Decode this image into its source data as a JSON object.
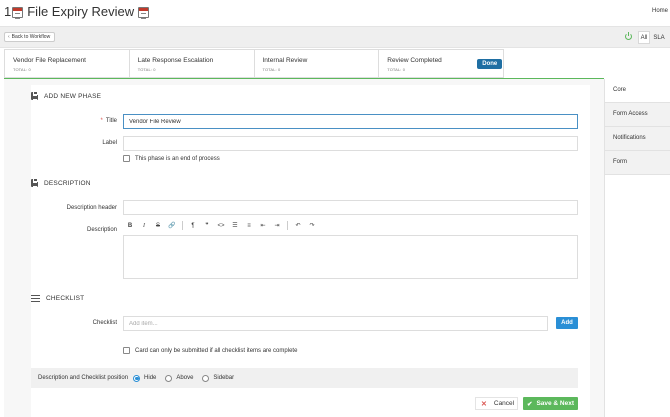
{
  "header": {
    "title_prefix": "1",
    "title": "File Expiry Review",
    "home_link": "Home"
  },
  "actionbar": {
    "back_label": "Back to Workflow",
    "filter_all": "All",
    "filter_sla": "SLA"
  },
  "stages": [
    {
      "name": "Vendor File Replacement",
      "total": "TOTAL: 0"
    },
    {
      "name": "Late Response Escalation",
      "total": "TOTAL: 0"
    },
    {
      "name": "Internal Review",
      "total": "TOTAL: 0"
    },
    {
      "name": "Review Completed",
      "total": "TOTAL: 0",
      "badge": "Done"
    }
  ],
  "add_phase": {
    "heading": "ADD NEW PHASE",
    "title_label": "Title",
    "title_value": "Vendor File Review",
    "label_label": "Label",
    "label_value": "",
    "end_process_label": "This phase is an end of process"
  },
  "description": {
    "heading": "DESCRIPTION",
    "header_label": "Description header",
    "header_value": "",
    "body_label": "Description",
    "toolbar": [
      "B",
      "I",
      "S",
      "link",
      "¶",
      "❞",
      "<>",
      "ul",
      "ol",
      "outdent",
      "indent",
      "undo",
      "redo"
    ]
  },
  "checklist": {
    "heading": "CHECKLIST",
    "label": "Checklist",
    "placeholder": "Add item...",
    "add_label": "Add",
    "require_label": "Card can only be submitted if all checklist items are complete"
  },
  "position": {
    "label": "Description and Checklist position",
    "options": [
      "Hide",
      "Above",
      "Sidebar"
    ],
    "selected": "Hide"
  },
  "footer": {
    "cancel_label": "Cancel",
    "save_label": "Save & Next"
  },
  "sidebar": {
    "items": [
      "Core",
      "Form Access",
      "Notifications",
      "Form"
    ]
  },
  "colors": {
    "primary": "#2a8fd6",
    "success": "#5cb85c",
    "done_badge": "#1f6fa3",
    "danger": "#d9534f"
  }
}
